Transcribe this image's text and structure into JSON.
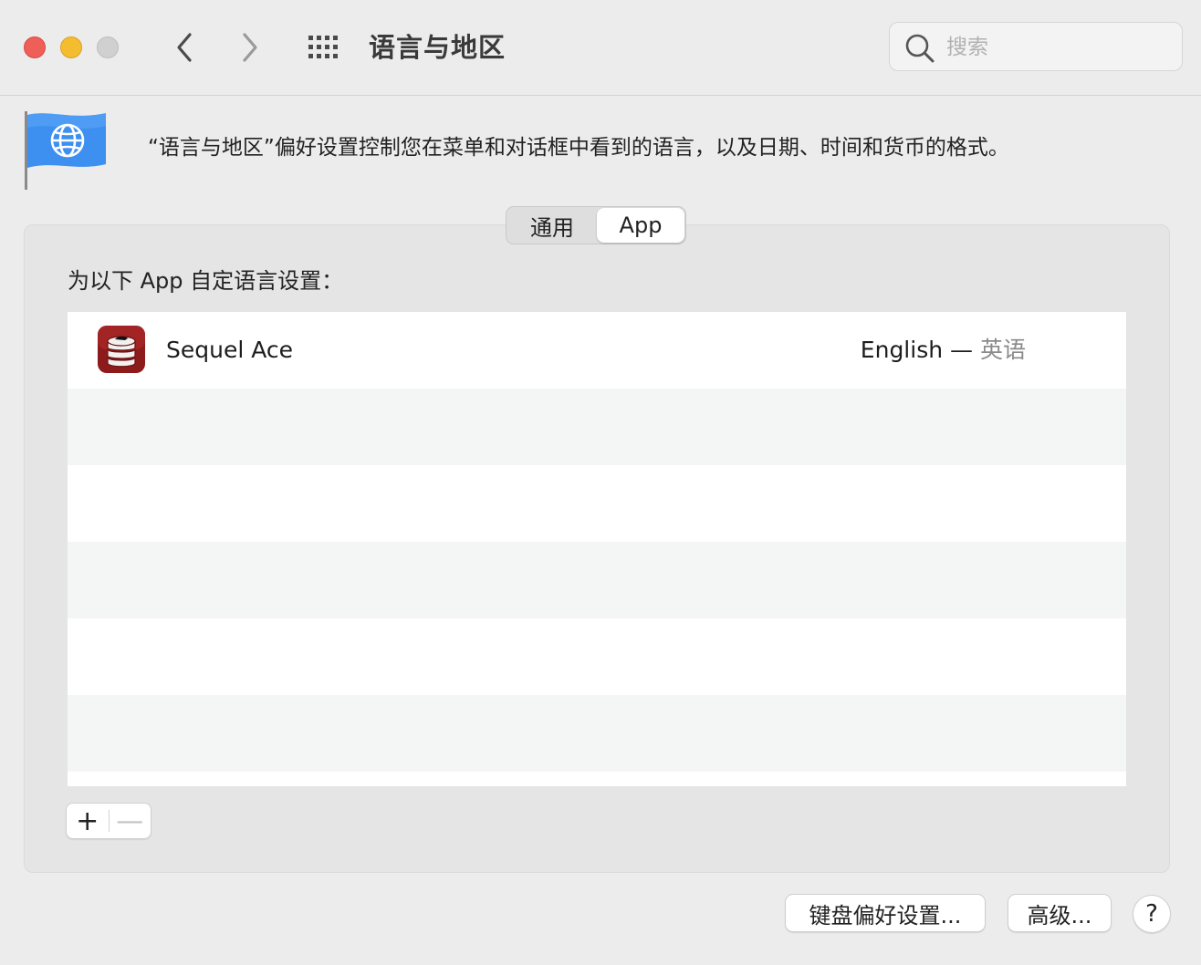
{
  "window": {
    "title": "语言与地区"
  },
  "search": {
    "placeholder": "搜索",
    "value": ""
  },
  "header": {
    "description": "“语言与地区”偏好设置控制您在菜单和对话框中看到的语言，以及日期、时间和货币的格式。"
  },
  "tabs": [
    {
      "label": "通用",
      "selected": false
    },
    {
      "label": "App",
      "selected": true
    }
  ],
  "app_list": {
    "label": "为以下 App 自定语言设置：",
    "items": [
      {
        "name": "Sequel Ace",
        "language": "English",
        "separator": " — ",
        "language_native": "英语"
      }
    ]
  },
  "list_controls": {
    "add": "+",
    "remove": "—"
  },
  "footer": {
    "keyboard_button": "键盘偏好设置...",
    "advanced_button": "高级...",
    "help_button": "?"
  },
  "colors": {
    "close": "#ee5f57",
    "minimize": "#f4bc2f",
    "zoom_disabled": "#d0d0d0",
    "flag_blue": "#3d8ff0",
    "app_icon_red": "#8e1b1b"
  }
}
